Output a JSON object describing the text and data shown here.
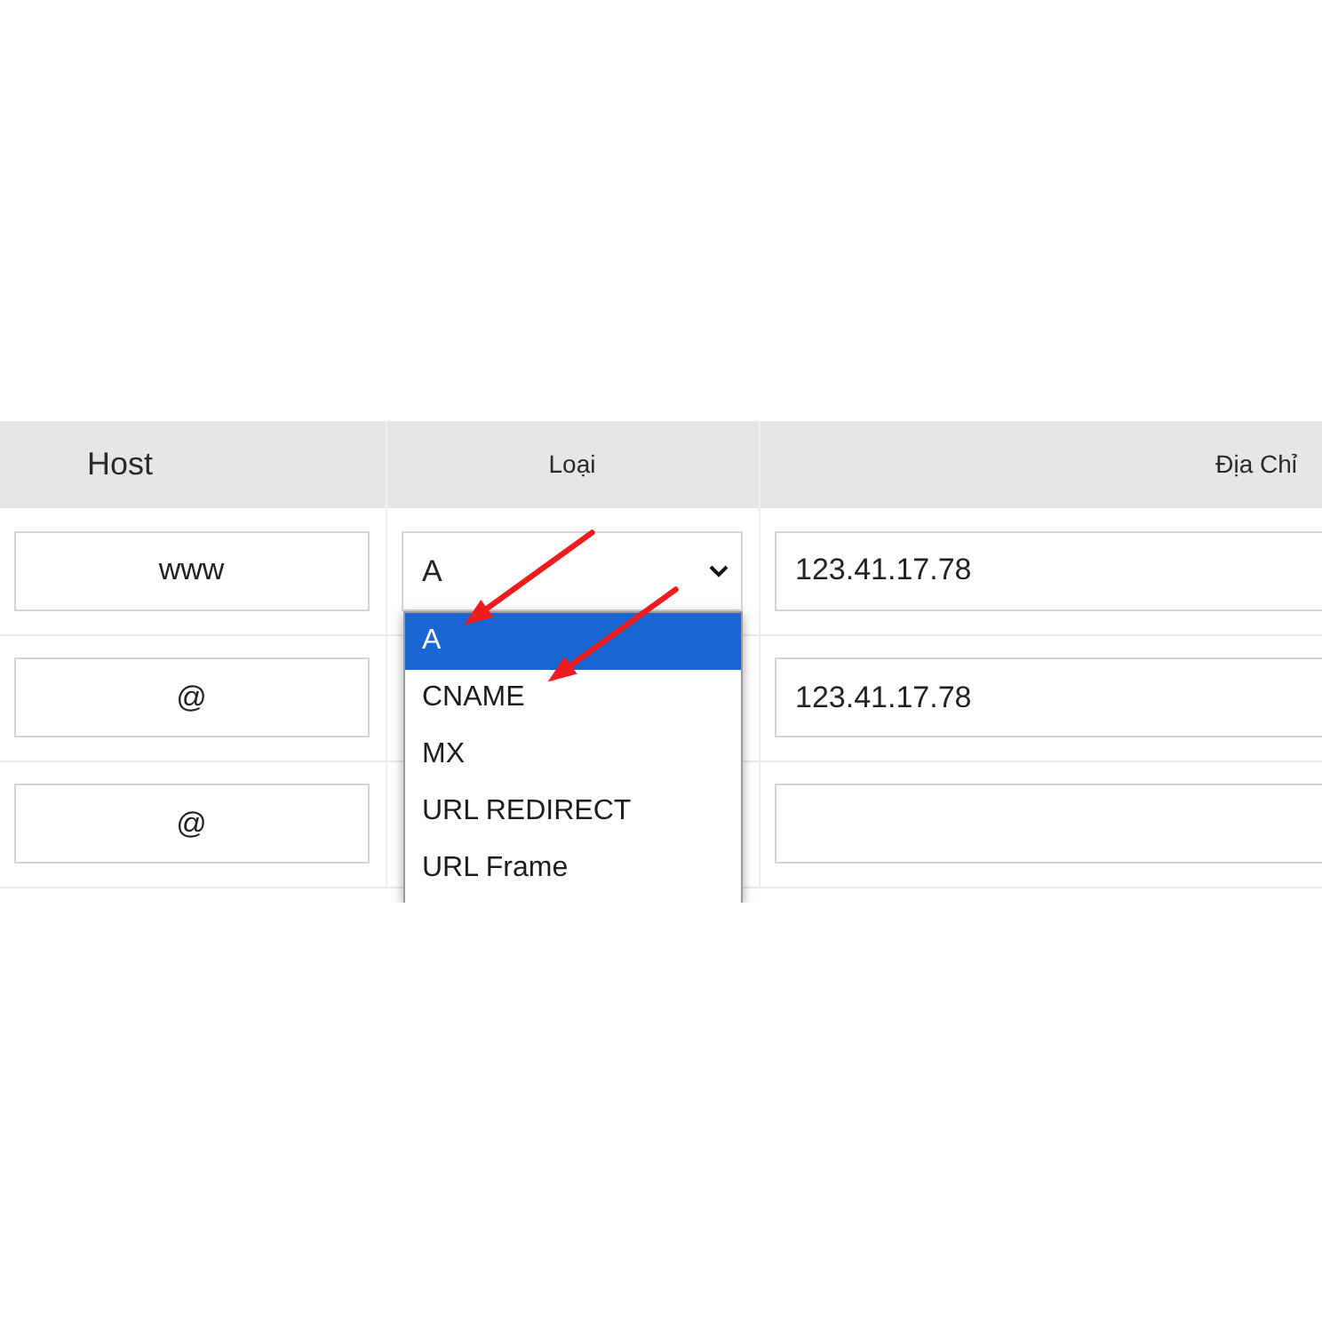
{
  "table": {
    "columns": [
      {
        "label": "Host"
      },
      {
        "label": "Loại"
      },
      {
        "label": "Địa Chỉ"
      }
    ],
    "rows": [
      {
        "host": "www",
        "type": "A",
        "expanded": true,
        "options": [
          {
            "label": "A",
            "selected": true,
            "marked": true
          },
          {
            "label": "CNAME",
            "selected": false,
            "marked": true
          },
          {
            "label": "MX",
            "selected": false,
            "marked": false
          },
          {
            "label": "URL REDIRECT",
            "selected": false,
            "marked": false
          },
          {
            "label": "URL Frame",
            "selected": false,
            "marked": false
          }
        ],
        "address": "123.41.17.78"
      },
      {
        "host": "@",
        "address": "123.41.17.78"
      },
      {
        "host": "@"
      }
    ]
  }
}
